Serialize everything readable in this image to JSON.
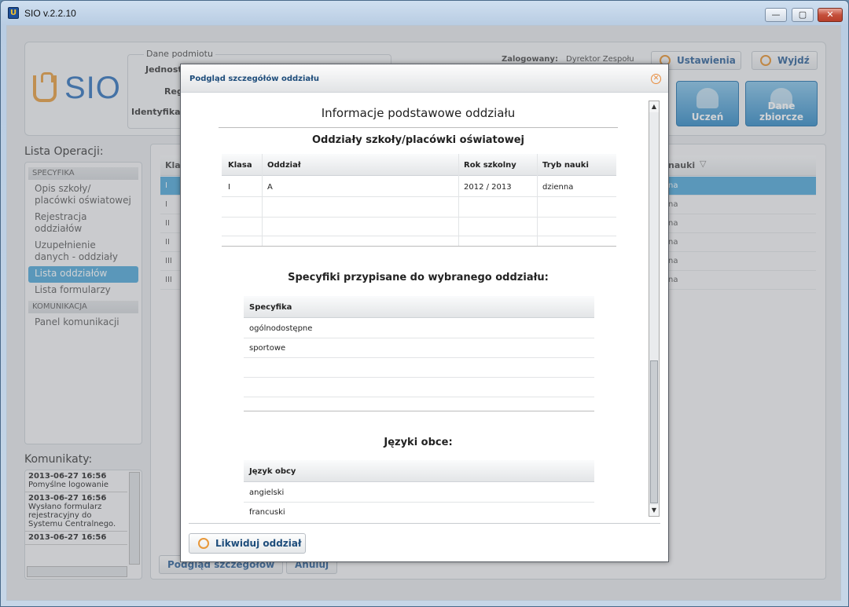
{
  "window": {
    "title": "SIO v.2.2.10",
    "min": "—",
    "max": "▢",
    "close": "✕",
    "icon": "U"
  },
  "header": {
    "logo_text": "SIO",
    "fieldset_legend": "Dane podmiotu",
    "field_labels": [
      "Jednost",
      "Reg",
      "Identyfikat"
    ],
    "logged_label": "Zalogowany:",
    "logged_user": "Dyrektor Zespołu",
    "settings_btn": "Ustawienia",
    "exit_btn": "Wyjdź",
    "student_btn": "Uczeń",
    "summary_btn": "Dane zbiorcze"
  },
  "operations": {
    "title": "Lista Operacji:",
    "sections": [
      {
        "name": "SPECYFIKA",
        "items": [
          "Opis szkoły/ placówki oświatowej",
          "Rejestracja oddziałów",
          "Uzupełnienie danych - oddziały",
          "Lista oddziałów",
          "Lista formularzy"
        ]
      },
      {
        "name": "KOMUNIKACJA",
        "items": [
          "Panel komunikacji"
        ]
      }
    ],
    "active": "Lista oddziałów"
  },
  "messages": {
    "title": "Komunikaty:",
    "entries": [
      {
        "date": "2013-06-27 16:56",
        "text": "Pomyślne logowanie"
      },
      {
        "date": "2013-06-27 16:56",
        "text": "Wysłano formularz rejestracyjny do Systemu Centralnego."
      },
      {
        "date": "2013-06-27 16:56",
        "text": ""
      }
    ]
  },
  "main_table": {
    "col_first": "Kla",
    "col_last": "nauki",
    "rows": [
      {
        "klasa": "I",
        "tryb": "na"
      },
      {
        "klasa": "I",
        "tryb": "na"
      },
      {
        "klasa": "II",
        "tryb": "na"
      },
      {
        "klasa": "II",
        "tryb": "na"
      },
      {
        "klasa": "III",
        "tryb": "na"
      },
      {
        "klasa": "III",
        "tryb": "na"
      }
    ],
    "btn_details": "Podgląd szczegółów",
    "btn_cancel": "Anuluj"
  },
  "dialog": {
    "title": "Podgląd szczegółów oddziału",
    "main_heading": "Informacje podstawowe oddziału",
    "units_heading": "Oddziały szkoły/placówki oświatowej",
    "units_columns": [
      "Klasa",
      "Oddział",
      "Rok szkolny",
      "Tryb nauki"
    ],
    "units_rows": [
      [
        "I",
        "A",
        "2012 / 2013",
        "dzienna"
      ]
    ],
    "spec_heading": "Specyfiki przypisane do wybranego oddziału:",
    "spec_column": "Specyfika",
    "spec_rows": [
      "ogólnodostępne",
      "sportowe"
    ],
    "lang_heading": "Języki obce:",
    "lang_column": "Język obcy",
    "lang_rows": [
      "angielski",
      "francuski"
    ],
    "action_btn": "Likwiduj oddział"
  }
}
